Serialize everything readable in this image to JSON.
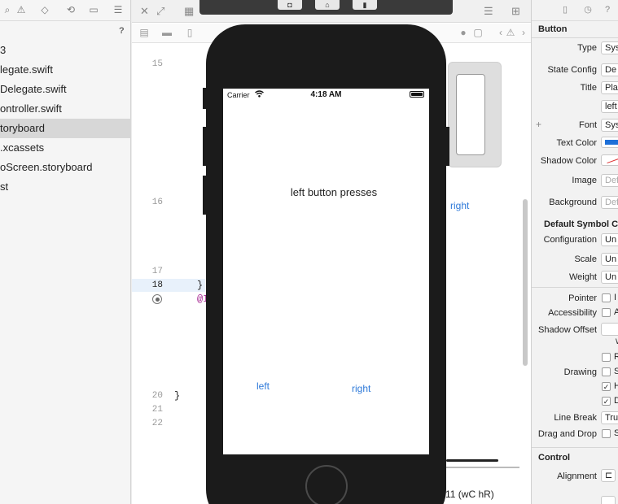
{
  "navigator": {
    "help_mark": "?",
    "items": [
      {
        "label": "3",
        "selected": false
      },
      {
        "label": "legate.swift",
        "selected": false
      },
      {
        "label": "Delegate.swift",
        "selected": false
      },
      {
        "label": "ontroller.swift",
        "selected": false
      },
      {
        "label": "toryboard",
        "selected": true
      },
      {
        "label": ".xcassets",
        "selected": false
      },
      {
        "label": "oScreen.storyboard",
        "selected": false
      },
      {
        "label": "st",
        "selected": false
      }
    ]
  },
  "editor": {
    "line_numbers": [
      "15",
      "16",
      "17",
      "18",
      "20",
      "21",
      "22"
    ],
    "code": {
      "line18": "}",
      "line19_partial": "@I",
      "line20": "}"
    },
    "background_right_link": "right",
    "device_config": "e 11 (wC hR)"
  },
  "simulator": {
    "carrier": "Carrier",
    "time": "4:18 AM",
    "main_label": "left button presses",
    "left_button": "left",
    "right_button": "right"
  },
  "inspector": {
    "section_button": "Button",
    "type_label": "Type",
    "type_value": "Sys",
    "state_config_label": "State Config",
    "state_config_value": "De",
    "title_label": "Title",
    "title_value": "Pla",
    "title_text": "left",
    "font_label": "Font",
    "font_value": "Sys",
    "text_color_label": "Text Color",
    "shadow_color_label": "Shadow Color",
    "image_label": "Image",
    "image_placeholder": "Def",
    "background_label": "Background",
    "background_placeholder": "Def",
    "default_symbol_config": "Default Symbol Co",
    "configuration_label": "Configuration",
    "configuration_value": "Un",
    "scale_label": "Scale",
    "scale_value": "Un",
    "weight_label": "Weight",
    "weight_value": "Un",
    "pointer_label": "Pointer",
    "pointer_text": "I",
    "accessibility_label": "Accessibility",
    "accessibility_text": "A",
    "shadow_offset_label": "Shadow Offset",
    "shadow_offset_w": "W",
    "drawing_r_text": "R",
    "drawing_label": "Drawing",
    "drawing_s_text": "S",
    "drawing_h_text": "H",
    "drawing_d_text": "D",
    "line_break_label": "Line Break",
    "line_break_value": "Tru",
    "drag_drop_label": "Drag and Drop",
    "drag_drop_text": "S",
    "section_control": "Control",
    "alignment_label": "Alignment"
  },
  "colors": {
    "accent_blue": "#2f7ad9",
    "text_color_swatch": "#1d6fd8",
    "device_frame": "#1b1b1b"
  }
}
